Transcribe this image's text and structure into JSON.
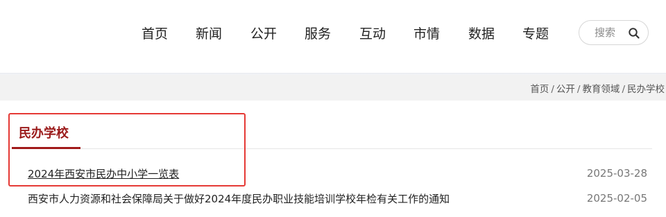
{
  "nav": {
    "items": [
      "首页",
      "新闻",
      "公开",
      "服务",
      "互动",
      "市情",
      "数据",
      "专题"
    ]
  },
  "search": {
    "placeholder": "搜索",
    "icon": "search-icon"
  },
  "breadcrumb": {
    "items": [
      "首页",
      "公开",
      "教育领域",
      "民办学校"
    ],
    "separator": "/"
  },
  "section": {
    "title": "民办学校",
    "accent_color": "#9b1b1b",
    "highlight_color": "#e53935"
  },
  "list": {
    "rows": [
      {
        "title": "2024年西安市民办中小学一览表",
        "date": "2025-03-28"
      },
      {
        "title": "西安市人力资源和社会保障局关于做好2024年度民办职业技能培训学校年检有关工作的通知",
        "date": "2025-02-05"
      }
    ]
  }
}
